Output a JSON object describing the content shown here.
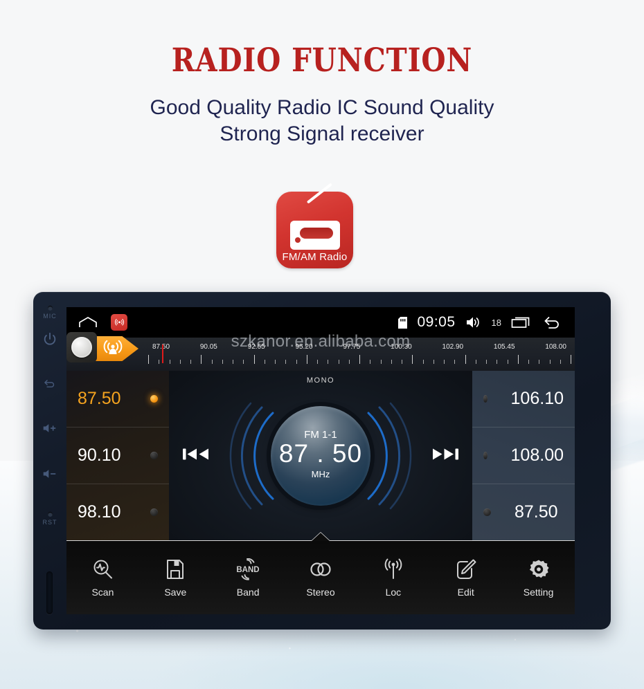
{
  "page": {
    "title": "RADIO FUNCTION",
    "subtitle_line1": "Good Quality Radio IC Sound Quality",
    "subtitle_line2": "Strong Signal receiver",
    "title_color": "#b7211f",
    "subtitle_color": "#1f2450",
    "background_color": "#f6f7f8"
  },
  "app_icon": {
    "label": "FM/AM Radio",
    "tile_color": "#d2342f",
    "icon_name": "fm-am-radio-icon"
  },
  "device": {
    "bezel": {
      "mic_label": "MIC",
      "reset_label": "RST",
      "buttons": [
        {
          "name": "power",
          "label": ""
        },
        {
          "name": "back",
          "label": ""
        },
        {
          "name": "volume-up",
          "label": ""
        },
        {
          "name": "volume-down",
          "label": ""
        }
      ]
    },
    "statusbar": {
      "home_icon": "home-icon",
      "app_icon": "radio-app-icon",
      "sdcard_icon": "sd-card-icon",
      "time": "09:05",
      "volume_icon": "volume-icon",
      "volume_level": "18",
      "recents_icon": "recent-apps-icon",
      "back_icon": "back-arrow-icon"
    },
    "watermark": "szkanor.en.alibaba.com",
    "banner": {
      "knob_icon": "tuning-knob-icon",
      "radio_icon": "broadcast-icon"
    },
    "ruler": {
      "labels": [
        "87.50",
        "90.05",
        "92.65",
        "95.20",
        "97.75",
        "100.30",
        "102.90",
        "105.45",
        "108.00"
      ],
      "needle_position_percent": 3.2
    },
    "presets_left": [
      {
        "value": "87.50",
        "active": true
      },
      {
        "value": "90.10",
        "active": false
      },
      {
        "value": "98.10",
        "active": false
      }
    ],
    "presets_right": [
      {
        "value": "106.10",
        "active": false
      },
      {
        "value": "108.00",
        "active": false
      },
      {
        "value": "87.50",
        "active": false
      }
    ],
    "dial": {
      "mono_label": "MONO",
      "band": "FM 1-1",
      "frequency": "87 . 50",
      "unit": "MHz",
      "prev_icon": "previous-station-icon",
      "next_icon": "next-station-icon"
    },
    "toolbar": [
      {
        "label": "Scan",
        "icon": "scan-icon"
      },
      {
        "label": "Save",
        "icon": "save-icon"
      },
      {
        "label": "Band",
        "icon": "band-icon"
      },
      {
        "label": "Stereo",
        "icon": "stereo-icon"
      },
      {
        "label": "Loc",
        "icon": "loc-antenna-icon"
      },
      {
        "label": "Edit",
        "icon": "edit-icon"
      },
      {
        "label": "Setting",
        "icon": "settings-gear-icon"
      }
    ]
  }
}
